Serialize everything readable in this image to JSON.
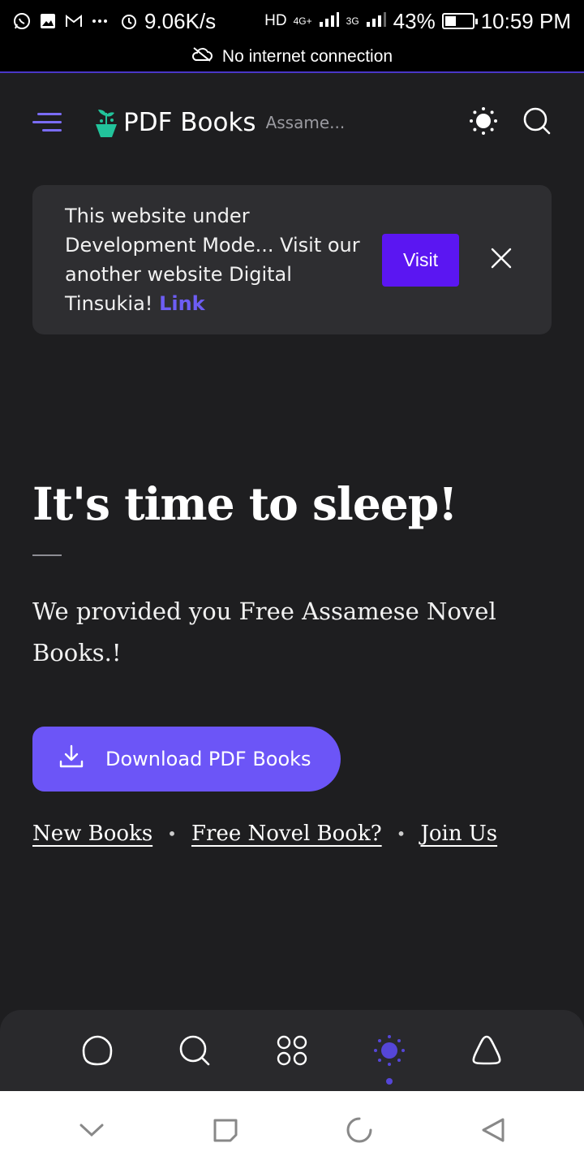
{
  "status_bar": {
    "net_speed": "9.06K/s",
    "hd_label": "HD",
    "sim1_type": "4G+",
    "sim2_type": "3G",
    "battery": "43%",
    "battery_level": 0.43,
    "time": "10:59 PM",
    "icons": [
      "whatsapp-icon",
      "gallery-icon",
      "gmail-icon",
      "more-icon",
      "alarm-icon",
      "signal-icon",
      "battery-icon"
    ]
  },
  "network_notice": {
    "text": "No internet connection",
    "icon": "cloud-off-icon"
  },
  "header": {
    "brand": "PDF Books",
    "sub": "Assame...",
    "icons": [
      "menu-icon",
      "logo-icon",
      "sun-icon",
      "search-icon"
    ]
  },
  "notice": {
    "message": "This website under Development Mode... Visit our another website Digital Tinsukia!",
    "link_label": "Link",
    "visit_label": "Visit"
  },
  "hero": {
    "title": "It's time to sleep!",
    "description": "We provided you Free Assamese Novel Books.!",
    "download_label": "Download PDF Books"
  },
  "links": [
    {
      "label": "New Books"
    },
    {
      "label": "Free Novel Book?"
    },
    {
      "label": "Join Us"
    }
  ],
  "bottom_nav": {
    "items": [
      "home-icon",
      "search-icon",
      "grid-icon",
      "sun-icon",
      "bell-icon"
    ],
    "active": "sun-icon"
  },
  "colors": {
    "background": "#1e1e20",
    "accent": "#6c55f7",
    "visit_button": "#5b16f2",
    "link": "#6d5df4"
  }
}
